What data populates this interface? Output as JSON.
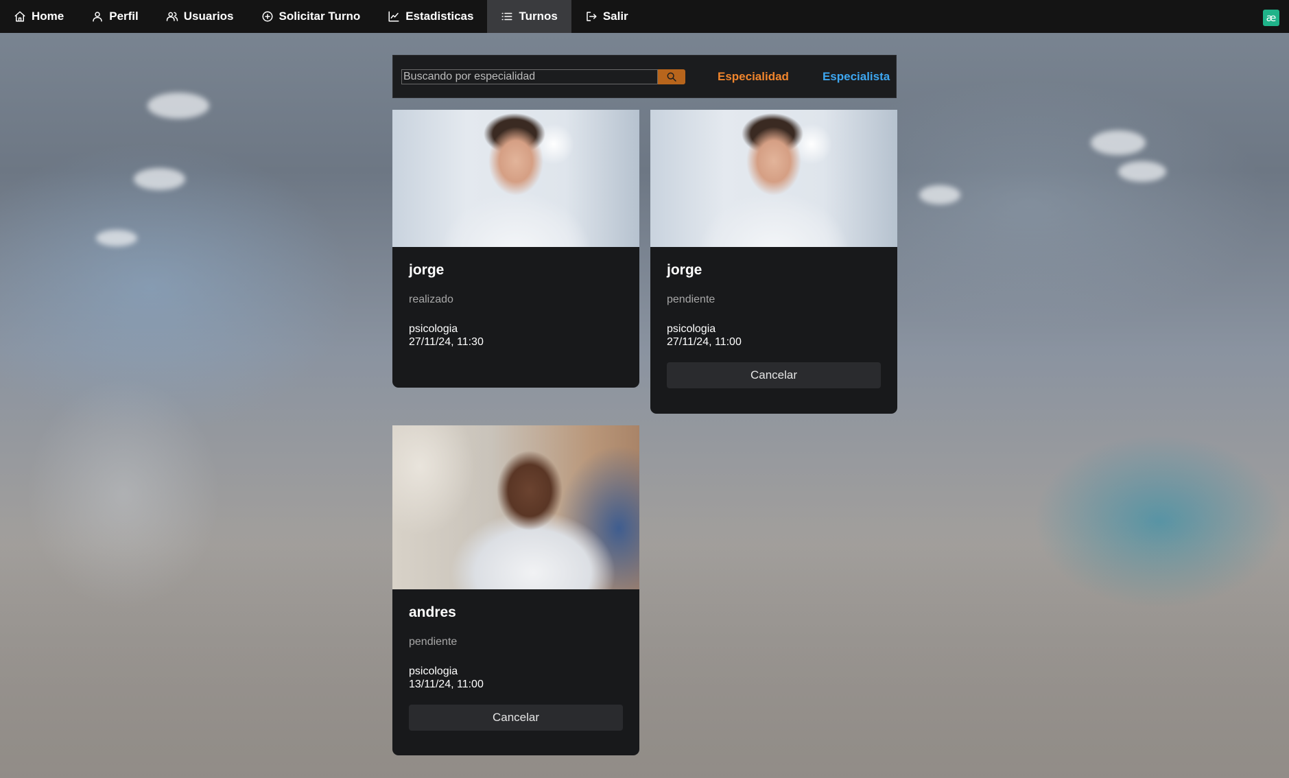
{
  "navbar": {
    "items": [
      {
        "label": "Home",
        "icon": "home-icon"
      },
      {
        "label": "Perfil",
        "icon": "user-icon"
      },
      {
        "label": "Usuarios",
        "icon": "users-icon"
      },
      {
        "label": "Solicitar Turno",
        "icon": "plus-circle-icon"
      },
      {
        "label": "Estadisticas",
        "icon": "chart-icon"
      },
      {
        "label": "Turnos",
        "icon": "list-icon",
        "active": true
      },
      {
        "label": "Salir",
        "icon": "logout-icon"
      }
    ],
    "logo_glyph": "æ",
    "logo_color": "#1fb389"
  },
  "search": {
    "placeholder": "Buscando por especialidad",
    "value": "",
    "button_icon": "search-icon",
    "button_color": "#b8651c"
  },
  "filters": {
    "especialidad_label": "Especialidad",
    "especialidad_color": "#f0852d",
    "especialista_label": "Especialista",
    "especialista_color": "#3da6f0"
  },
  "turnos": [
    {
      "name": "jorge",
      "status": "realizado",
      "specialty": "psicologia",
      "datetime": "27/11/24, 11:30",
      "photo": "doctor-jorge-photo",
      "cancel_label": null
    },
    {
      "name": "jorge",
      "status": "pendiente",
      "specialty": "psicologia",
      "datetime": "27/11/24, 11:00",
      "photo": "doctor-jorge-photo",
      "cancel_label": "Cancelar"
    },
    {
      "name": "andres",
      "status": "pendiente",
      "specialty": "psicologia",
      "datetime": "13/11/24, 11:00",
      "photo": "doctor-andres-photo",
      "cancel_label": "Cancelar"
    }
  ]
}
